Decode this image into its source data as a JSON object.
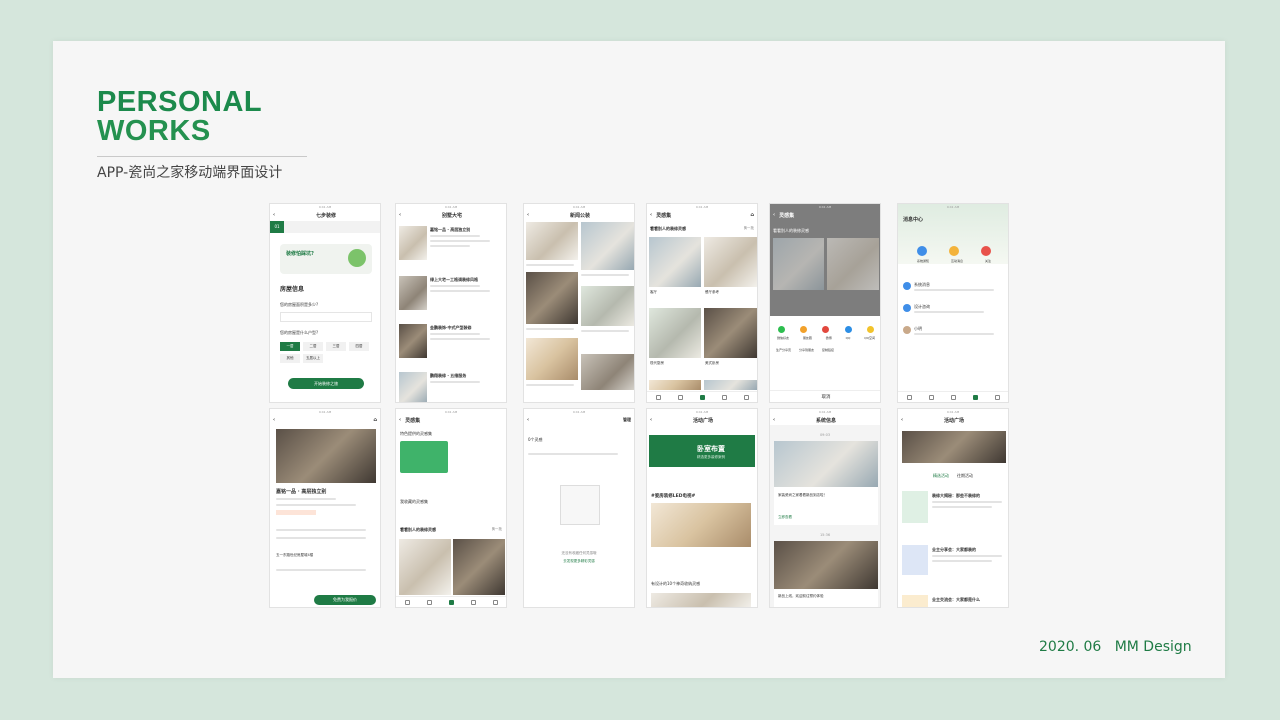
{
  "header": {
    "title_line1": "PERSONAL",
    "title_line2": "WORKS",
    "subtitle": "APP-瓷尚之家移动端界面设计"
  },
  "footer": {
    "date": "2020. 06",
    "brand": "MM Design"
  },
  "screens": {
    "s1": {
      "title": "七步装修",
      "section": "房屋信息",
      "q1": "您的房屋面积是多少?",
      "q2": "您的房屋是什么户型?",
      "chips": [
        "一居",
        "二居",
        "三居",
        "四居",
        "其他",
        "五居以上"
      ],
      "cta": "开始装修之旅",
      "bubble": "装修怕踩坑?"
    },
    "s2": {
      "title": "别墅大宅",
      "items": [
        "嘉铭一品 · 高层独立别",
        "绿上大宅—工格调装修风格",
        "金鹏装饰·中式产型装修",
        "鹏翔装修 · 五维服务"
      ]
    },
    "s3": {
      "title": "新闻公装"
    },
    "s4": {
      "title": "灵感集",
      "section": "看看别人的装修灵感",
      "refresh": "换一批",
      "labels": [
        "客厅",
        "餐厅参考",
        "现代厨房",
        "美式卧房"
      ]
    },
    "s5": {
      "title": "灵感集",
      "section": "看看别人的装修灵感",
      "share_title": "分享到",
      "share_items": [
        "微信好友",
        "朋友圈",
        "微博",
        "QQ",
        "QQ空间"
      ],
      "extra_items": [
        "生产分享页",
        "分享到朋友",
        "复制链接"
      ],
      "cancel": "取消"
    },
    "s6": {
      "title": "消息中心",
      "tabs": [
        "系统通知",
        "互动消息",
        "关注"
      ],
      "rows": [
        "系统消息",
        "设计咨询",
        "小明"
      ]
    },
    "s7": {
      "name": "嘉铭一品 · 高层独立别",
      "cta": "免费为我报价",
      "addr": "五一东路世纪房屋城4楼"
    },
    "s8": {
      "title": "灵感集",
      "section1": "特色提供的灵感集",
      "section2": "我收藏的灵感集",
      "section3": "看看别人的装修灵感",
      "refresh": "换一批"
    },
    "s9": {
      "title": "",
      "manage": "管理",
      "count": "0个灵感",
      "hint": "还没有收藏任何灵感哦",
      "link": "去发现更多精彩灵感"
    },
    "s10": {
      "title": "活动广场",
      "banner_top": "卧室布置",
      "banner_sub": "精选更多装修案例",
      "tag": "#瓷房装修LED电视#",
      "section": "有设计的10个神奇收纳灵感"
    },
    "s11": {
      "title": "系统信息",
      "time1": "09:03",
      "time2": "15:36",
      "msg1": "家装瓷尚之家看看新品到店啦！",
      "link1": "立即查看",
      "msg2": "新品上线，欢迎前往预约体验"
    },
    "s12": {
      "title": "活动广场",
      "tabs": [
        "精选活动",
        "往期活动"
      ],
      "items": [
        "装修大揭秘：那些不装修的",
        "业主分享会：大家都装的",
        "业主交流会：大家都是什么"
      ]
    }
  },
  "colors": {
    "brand_green": "#1f7b45",
    "card_bg": "#f6f6f6",
    "page_bg": "#d5e6dc"
  }
}
